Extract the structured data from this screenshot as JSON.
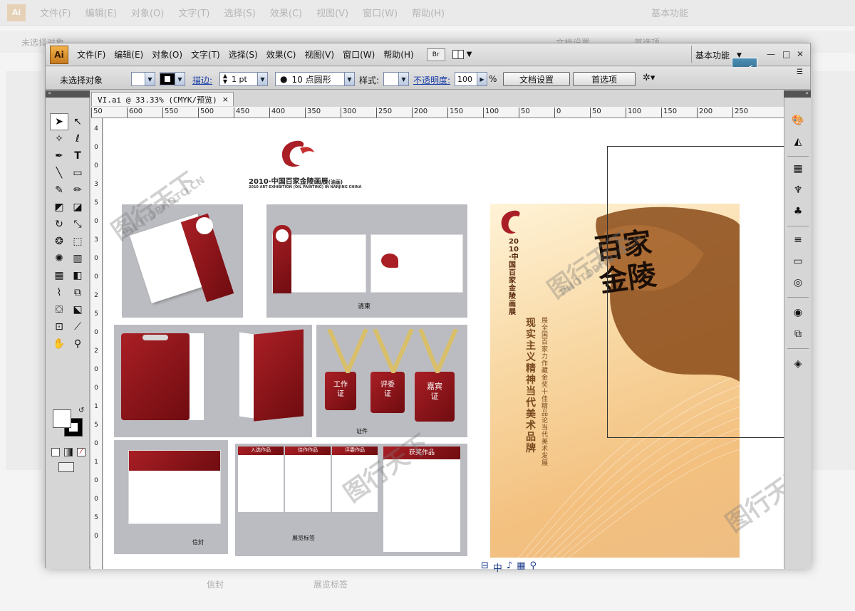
{
  "background_app": {
    "menu": [
      "文件(F)",
      "编辑(E)",
      "对象(O)",
      "文字(T)",
      "选择(S)",
      "效果(C)",
      "视图(V)",
      "窗口(W)",
      "帮助(H)"
    ],
    "workspace": "基本功能",
    "no_selection": "未选择对象",
    "doc_setup": "文档设置",
    "preferences": "首选项",
    "bottom_labels": [
      "信封",
      "展览标签"
    ]
  },
  "menubar": {
    "logo": "Ai",
    "items": [
      "文件(F)",
      "编辑(E)",
      "对象(O)",
      "文字(T)",
      "选择(S)",
      "效果(C)",
      "视图(V)",
      "窗口(W)",
      "帮助(H)"
    ],
    "bridge": "Br",
    "workspace": "基本功能",
    "window_controls": [
      "—",
      "□",
      "✕"
    ]
  },
  "control_bar": {
    "selection": "未选择对象",
    "stroke_label": "描边:",
    "stroke_width": "1 pt",
    "brush": "10 点圆形",
    "style_label": "样式:",
    "opacity_label": "不透明度:",
    "opacity_value": "100",
    "percent": "%",
    "doc_setup_button": "文档设置",
    "preferences_button": "首选项"
  },
  "document": {
    "tab_title": "VI.ai @ 33.33% (CMYK/预览)",
    "close": "×",
    "ruler_h": [
      "50",
      "600",
      "550",
      "500",
      "450",
      "400",
      "350",
      "300",
      "250",
      "200",
      "150",
      "100",
      "50",
      "0",
      "50",
      "100",
      "150",
      "200",
      "250"
    ],
    "ruler_v": [
      "4",
      "0",
      "0",
      "3",
      "5",
      "0",
      "3",
      "0",
      "0",
      "2",
      "5",
      "0",
      "2",
      "0",
      "0",
      "1",
      "5",
      "0",
      "1",
      "0",
      "0",
      "5",
      "0"
    ]
  },
  "artwork": {
    "exhibition_title": "2010·中国百家金陵画展",
    "exhibition_title_suffix": "(油画)",
    "exhibition_subtitle": "2010 ART EXHIBITION (OIL PAINTING) IN NANJING CHINA",
    "invitation_label": "请柬",
    "badges": [
      "工作证",
      "评委证",
      "嘉宾证"
    ],
    "badges_label": "证件",
    "envelope_label": "信封",
    "labels_label": "展览标签",
    "label_cards": [
      "入选作品",
      "佳作作品",
      "评委作品",
      "获奖作品"
    ],
    "poster_title": "2010·中国百家金陵画展",
    "poster_lines": [
      "现实主义精神 当代美术品牌",
      "展全国百家力作 藏金奖十佳精品 论当代美术发展"
    ],
    "calligraphy": "百家金陵",
    "watermark": "图行天下",
    "watermark_en": "PHOTOPHOTO.CN"
  },
  "colors": {
    "brand_red": "#a91f25",
    "board_gray": "#bbbcc1",
    "poster_orange": "#f3c07f"
  }
}
